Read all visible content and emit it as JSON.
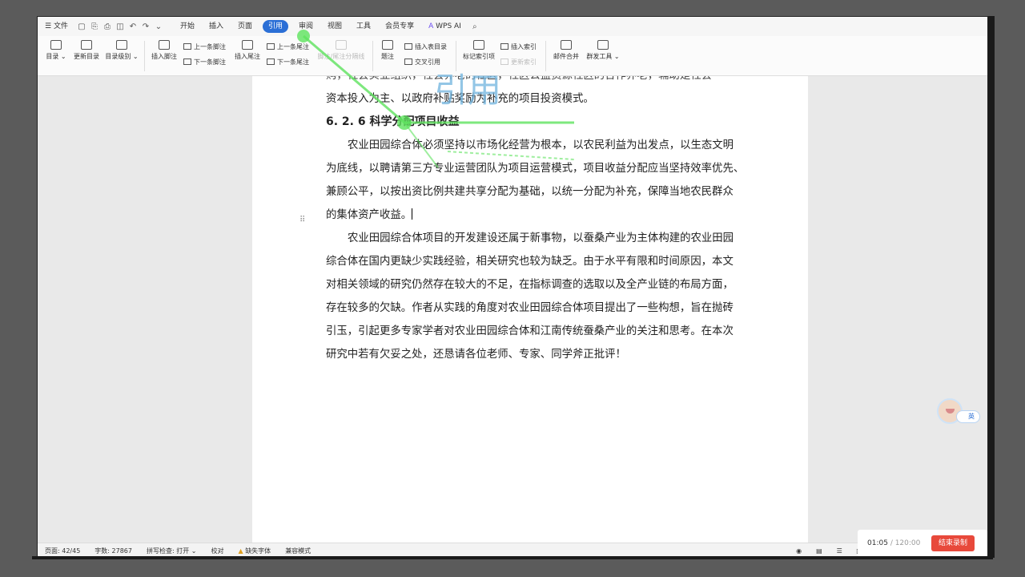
{
  "menu": {
    "file": "文件",
    "tabs": [
      "开始",
      "插入",
      "页面",
      "引用",
      "审阅",
      "视图",
      "工具",
      "会员专享"
    ],
    "active_tab": "引用",
    "wps_ai": "WPS AI"
  },
  "ribbon": {
    "toc": "目录",
    "update_toc": "更新目录",
    "toc_level": "目录级别",
    "insert_footnote": "插入脚注",
    "prev_footnote": "上一条脚注",
    "next_footnote": "下一条脚注",
    "insert_endnote": "插入尾注",
    "prev_endnote": "上一条尾注",
    "next_endnote": "下一条尾注",
    "footnote_separator": "脚注/尾注分隔线",
    "caption": "题注",
    "insert_table_of_figures": "插入表目录",
    "cross_reference": "交叉引用",
    "mark_index_entry": "标记索引项",
    "insert_index": "插入索引",
    "update_index": "更新索引",
    "mail_merge": "邮件合并",
    "bulk_tools": "群发工具"
  },
  "document": {
    "partial_line": "购，社会实业组织，社会养老的社区，社区公益资源社区的合作养老，辅助是社会",
    "line_capital": "资本投入为主、以政府补贴奖励为补充的项目投资模式。",
    "heading": "6. 2. 6 科学分配项目收益",
    "para1": [
      "农业田园综合体必须坚持以市场化经营为根本，以农民利益为出发点，以生态文明",
      "为底线，以聘请第三方专业运营团队为项目运营模式，项目收益分配应当坚持效率优先、",
      "兼顾公平，以按出资比例共建共享分配为基础，以统一分配为补充，保障当地农民群众",
      "的集体资产收益。"
    ],
    "para2": [
      "农业田园综合体项目的开发建设还属于新事物，以蚕桑产业为主体构建的农业田园",
      "综合体在国内更缺少实践经验，相关研究也较为缺乏。由于水平有限和时间原因，本文",
      "对相关领域的研究仍然存在较大的不足，在指标调查的选取以及全产业链的布局方面，",
      "存在较多的欠缺。作者从实践的角度对农业田园综合体项目提出了一些构想，旨在抛砖",
      "引玉，引起更多专家学者对农业田园综合体和江南传统蚕桑产业的关注和思考。在本次",
      "研究中若有欠妥之处，还恳请各位老师、专家、同学斧正批评！"
    ]
  },
  "overlay_title": "引用",
  "status": {
    "page": "页面: 42/45",
    "words": "字数: 27867",
    "spellcheck": "拼写检查: 打开",
    "proofread": "校对",
    "missing_font": "缺失字体",
    "compat_mode": "兼容模式"
  },
  "recording": {
    "elapsed": "01:05",
    "total": "/ 120:00",
    "stop": "结束录制"
  },
  "lang_badge": "英",
  "colors": {
    "accent": "#2b6fd6",
    "record": "#e8493b",
    "laser": "#5ee35e"
  }
}
